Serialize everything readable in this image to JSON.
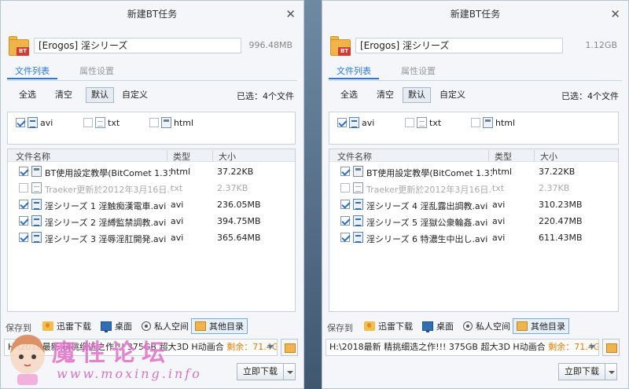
{
  "dialogs": [
    {
      "title": "新建BT任务",
      "folder_badge": "BT",
      "task_name": "[Erogos] 淫シリーズ",
      "total_size": "996.48MB",
      "tabs": [
        "文件列表",
        "属性设置"
      ],
      "filters": [
        "全选",
        "清空",
        "默认",
        "自定义"
      ],
      "selected_filter": "默认",
      "selected_count": "已选：4个文件",
      "types": [
        {
          "label": "avi",
          "checked": true,
          "icon": "avi-file-icon"
        },
        {
          "label": "txt",
          "checked": false,
          "icon": "txt-file-icon"
        },
        {
          "label": "html",
          "checked": false,
          "icon": "html-file-icon"
        }
      ],
      "columns": [
        "文件名称",
        "类型",
        "大小"
      ],
      "files": [
        {
          "name": "BT使用設定教學(BitComet 1.31)(...",
          "type": "html",
          "size": "37.22KB",
          "checked": true,
          "icon": "html"
        },
        {
          "name": "Traeker更新於2012年3月16日.txt",
          "type": "txt",
          "size": "2.37KB",
          "checked": false,
          "icon": "txt"
        },
        {
          "name": "淫シリーズ 1 淫触痴漢電車.avi",
          "type": "avi",
          "size": "236.05MB",
          "checked": true,
          "icon": "avi"
        },
        {
          "name": "淫シリーズ 2 淫縛監禁調教.avi",
          "type": "avi",
          "size": "394.75MB",
          "checked": true,
          "icon": "avi"
        },
        {
          "name": "淫シリーズ 3 淫辱淫肛開発.avi",
          "type": "avi",
          "size": "365.64MB",
          "checked": true,
          "icon": "avi"
        }
      ],
      "save_label": "保存到",
      "save_buttons": [
        "迅雷下载",
        "桌面",
        "私人空间",
        "其他目录"
      ],
      "save_selected": "其他目录",
      "path_prefix": "H:\\2018最新 精挑细选之作!!! 375GB  超大3D H动画合",
      "path_remaining": "剩余：71.4GB",
      "download_label": "立即下载"
    },
    {
      "title": "新建BT任务",
      "folder_badge": "BT",
      "task_name": "[Erogos] 淫シリーズ",
      "total_size": "1.12GB",
      "tabs": [
        "文件列表",
        "属性设置"
      ],
      "filters": [
        "全选",
        "清空",
        "默认",
        "自定义"
      ],
      "selected_filter": "默认",
      "selected_count": "已选：4个文件",
      "types": [
        {
          "label": "avi",
          "checked": true,
          "icon": "avi-file-icon"
        },
        {
          "label": "txt",
          "checked": false,
          "icon": "txt-file-icon"
        },
        {
          "label": "html",
          "checked": false,
          "icon": "html-file-icon"
        }
      ],
      "columns": [
        "文件名称",
        "类型",
        "大小"
      ],
      "files": [
        {
          "name": "BT使用設定教學(BitComet 1.31)(...",
          "type": "html",
          "size": "37.22KB",
          "checked": true,
          "icon": "html"
        },
        {
          "name": "Traeker更新於2012年3月16日.txt",
          "type": "txt",
          "size": "2.37KB",
          "checked": false,
          "icon": "txt"
        },
        {
          "name": "淫シリーズ 4 淫乱露出調教.avi",
          "type": "avi",
          "size": "310.23MB",
          "checked": true,
          "icon": "avi"
        },
        {
          "name": "淫シリーズ 5 淫獄公衆輪姦.avi",
          "type": "avi",
          "size": "220.47MB",
          "checked": true,
          "icon": "avi"
        },
        {
          "name": "淫シリーズ 6 特濃生中出し.avi",
          "type": "avi",
          "size": "611.43MB",
          "checked": true,
          "icon": "avi"
        }
      ],
      "save_label": "保存到",
      "save_buttons": [
        "迅雷下载",
        "桌面",
        "私人空间",
        "其他目录"
      ],
      "save_selected": "其他目录",
      "path_prefix": "H:\\2018最新 精挑细选之作!!! 375GB  超大3D H动画合",
      "path_remaining": "剩余：71.4GB",
      "download_label": "立即下载"
    }
  ],
  "watermark": {
    "text": "魔性论坛",
    "url": "www.moxing.info"
  },
  "colors": {
    "accent": "#2a7ad8",
    "remaining": "#e07a00",
    "watermark": "#e070c8"
  }
}
